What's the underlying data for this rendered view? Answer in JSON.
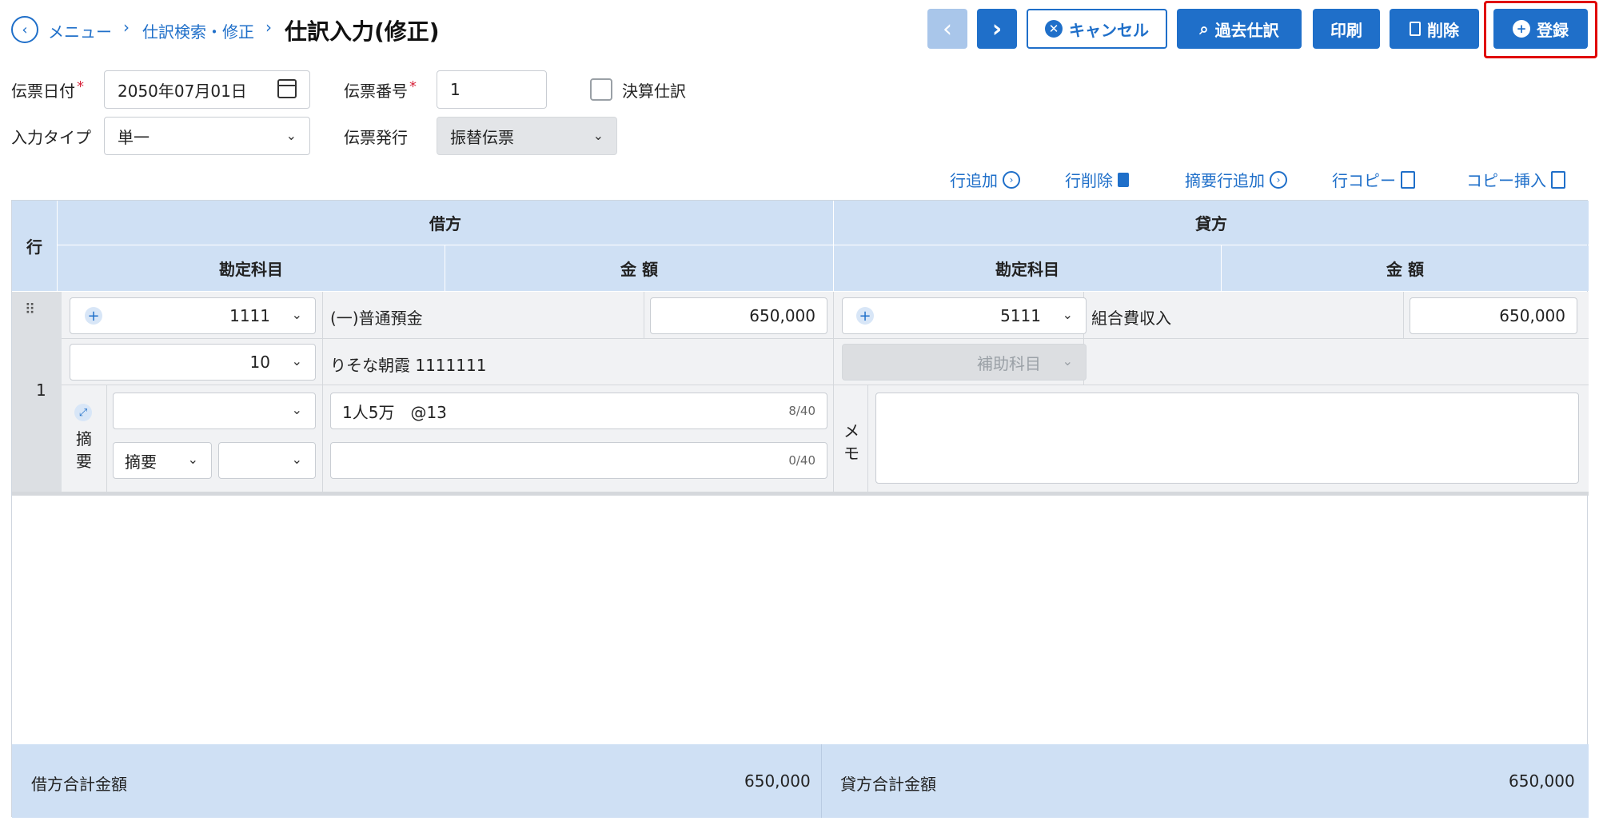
{
  "breadcrumb": {
    "menu": "メニュー",
    "search": "仕訳検索・修正",
    "sep": "›"
  },
  "page_title": "仕訳入力(修正)",
  "toolbar": {
    "prev_label": "‹",
    "next_label": "›",
    "cancel_label": "キャンセル",
    "past_label": "過去仕訳",
    "print_label": "印刷",
    "delete_label": "削除",
    "register_label": "登録"
  },
  "form": {
    "date_label": "伝票日付",
    "date_value": "2050年07月01日",
    "number_label": "伝票番号",
    "number_value": "1",
    "settlement_label": "決算仕訳",
    "input_type_label": "入力タイプ",
    "input_type_value": "単一",
    "issue_label": "伝票発行",
    "issue_value": "振替伝票",
    "required_mark": "*"
  },
  "actions": {
    "add_row": "行追加",
    "delete_row": "行削除",
    "add_summary_row": "摘要行追加",
    "copy_row": "行コピー",
    "copy_insert": "コピー挿入"
  },
  "table": {
    "row_header": "行",
    "debit_header": "借方",
    "credit_header": "貸方",
    "account_header": "勘定科目",
    "amount_header": "金 額",
    "rows": [
      {
        "row_no": "1",
        "debit_code": "1111",
        "debit_name": "(一)普通預金",
        "debit_amount": "650,000",
        "debit_sub_code": "10",
        "debit_sub_name": "りそな朝霞 1111111",
        "credit_code": "5111",
        "credit_name": "組合費収入",
        "credit_amount": "650,000",
        "credit_sub_placeholder": "補助科目",
        "summary_label_1": "摘",
        "summary_label_2": "要",
        "summary_text_1": "1人5万　@13",
        "summary_counter_1": "8/40",
        "summary_select": "摘要",
        "summary_counter_2": "0/40",
        "memo_label_1": "メ",
        "memo_label_2": "モ"
      }
    ]
  },
  "totals": {
    "debit_label": "借方合計金額",
    "debit_value": "650,000",
    "credit_label": "貸方合計金額",
    "credit_value": "650,000"
  }
}
